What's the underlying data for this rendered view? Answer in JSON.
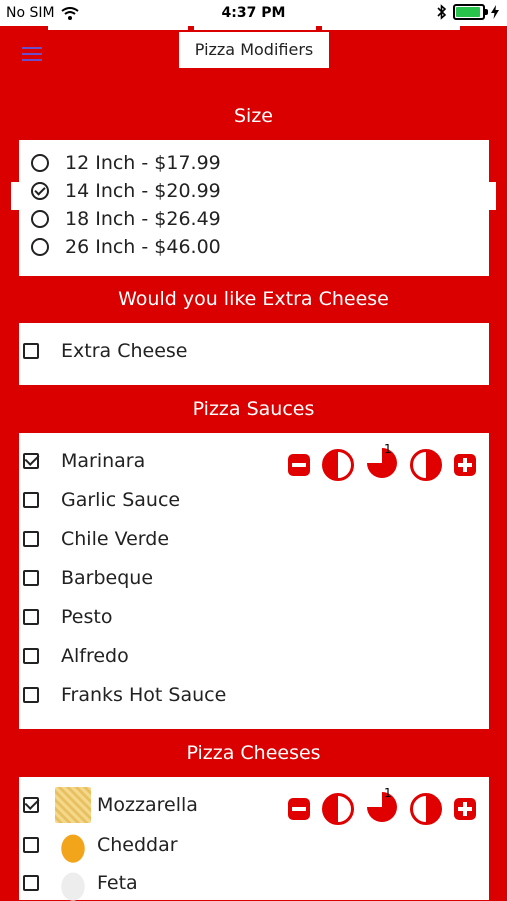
{
  "status_bar": {
    "carrier": "No SIM",
    "time": "4:37 PM"
  },
  "header": {
    "title": "Pizza Modifiers"
  },
  "size_section": {
    "title": "Size",
    "options": [
      {
        "label": "12 Inch - $17.99",
        "selected": false
      },
      {
        "label": "14 Inch - $20.99",
        "selected": true
      },
      {
        "label": "18 Inch - $26.49",
        "selected": false
      },
      {
        "label": "26 Inch - $46.00",
        "selected": false
      }
    ]
  },
  "extra_cheese_section": {
    "title": "Would you like Extra Cheese",
    "options": [
      {
        "label": "Extra Cheese",
        "checked": false
      }
    ]
  },
  "sauces_section": {
    "title": "Pizza Sauces",
    "options": [
      {
        "label": "Marinara",
        "checked": true
      },
      {
        "label": "Garlic Sauce",
        "checked": false
      },
      {
        "label": "Chile Verde",
        "checked": false
      },
      {
        "label": "Barbeque",
        "checked": false
      },
      {
        "label": "Pesto",
        "checked": false
      },
      {
        "label": "Alfredo",
        "checked": false
      },
      {
        "label": "Franks Hot Sauce",
        "checked": false
      }
    ],
    "portion_badge": "1"
  },
  "cheeses_section": {
    "title": "Pizza Cheeses",
    "options": [
      {
        "label": "Mozzarella",
        "checked": true
      },
      {
        "label": "Cheddar",
        "checked": false
      },
      {
        "label": "Feta",
        "checked": false
      }
    ],
    "portion_badge": "1"
  },
  "colors": {
    "background": "#da0000",
    "card": "#ffffff",
    "control_red": "#e00000",
    "menu_icon": "#6b4fc9"
  },
  "icons": {
    "minus": "minus-square-icon",
    "left_half": "left-half-icon",
    "three_quarter": "three-quarter-icon",
    "right_half": "right-half-icon",
    "plus": "plus-square-icon"
  }
}
